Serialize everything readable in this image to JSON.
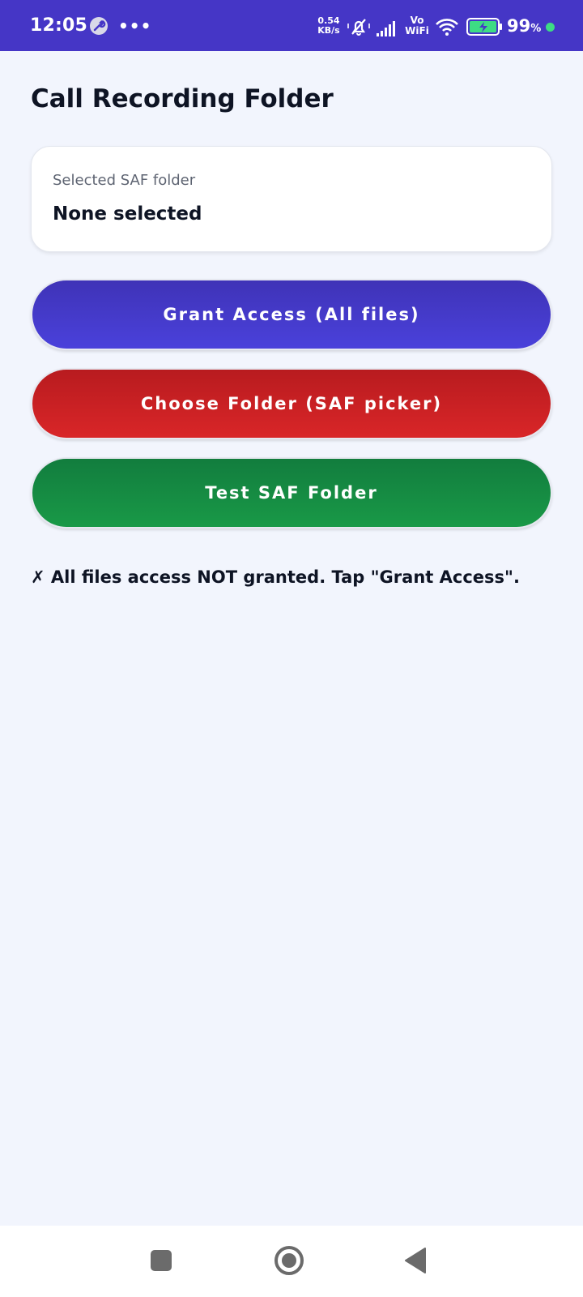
{
  "status_bar": {
    "time": "12:05",
    "more": "•••",
    "net_speed_value": "0.54",
    "net_speed_unit": "KB/s",
    "vo": "Vo",
    "wifi_label": "WiFi",
    "battery": "99",
    "battery_symbol": "%",
    "icons": [
      "wrench-icon",
      "mute-icon",
      "signal-icon",
      "wifi-icon",
      "battery-charging-icon"
    ],
    "bar_color": "#4536c6"
  },
  "page": {
    "title": "Call Recording Folder"
  },
  "folder_card": {
    "label": "Selected SAF folder",
    "value": "None selected"
  },
  "buttons": {
    "grant": "Grant Access (All files)",
    "choose": "Choose Folder (SAF picker)",
    "test": "Test SAF Folder"
  },
  "colors": {
    "grant": "#4a41db",
    "choose": "#d92628",
    "test": "#199947"
  },
  "status_message": "✗ All files access NOT granted. Tap \"Grant Access\".",
  "nav": {
    "icons": [
      "recents-icon",
      "home-icon",
      "back-icon"
    ]
  }
}
